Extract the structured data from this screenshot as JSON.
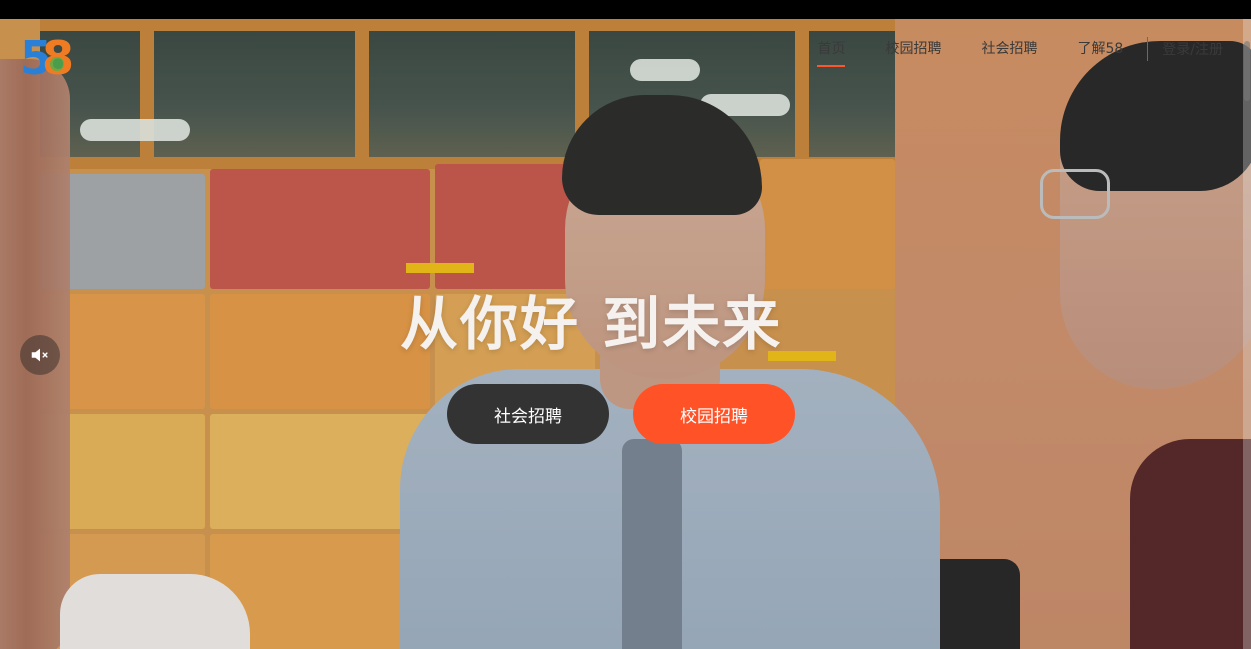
{
  "header": {
    "logo_text_1": "5",
    "logo_text_2": "8",
    "nav": [
      {
        "label": "首页",
        "active": true
      },
      {
        "label": "校园招聘",
        "active": false
      },
      {
        "label": "社会招聘",
        "active": false
      },
      {
        "label": "了解58",
        "active": false
      }
    ],
    "login_label": "登录/注册"
  },
  "hero": {
    "slogan": "从你好 到未来",
    "buttons": {
      "social_label": "社会招聘",
      "campus_label": "校园招聘"
    },
    "mute_icon": "volume-muted-icon"
  },
  "colors": {
    "accent": "#ff5227",
    "dark_button": "#333333",
    "slogan_bar": "#e1b417"
  }
}
